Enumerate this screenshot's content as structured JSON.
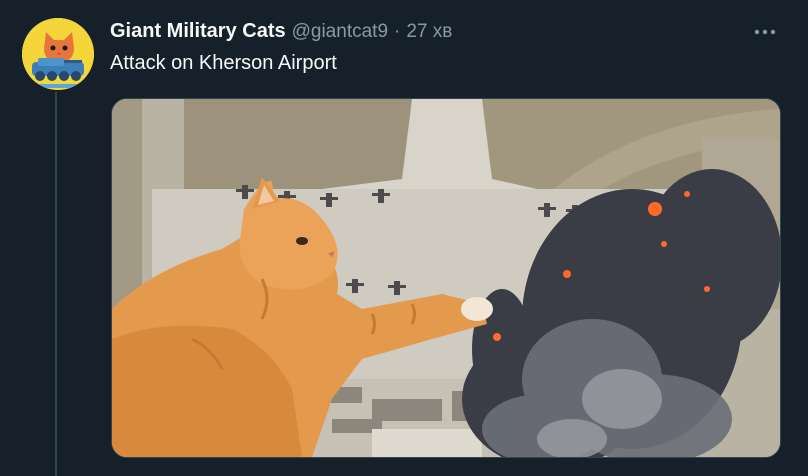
{
  "tweet": {
    "display_name": "Giant Military Cats",
    "handle": "@giantcat9",
    "separator": "·",
    "time": "27 хв",
    "text": "Attack on Kherson Airport",
    "more_icon": "more-horizontal-icon",
    "avatar_icon": "cat-avatar"
  },
  "colors": {
    "background": "#15202b",
    "text": "#f7f9f9",
    "muted": "#8b98a5",
    "avatar_bg": "#f5d63a",
    "cat_orange": "#e49a4a"
  }
}
